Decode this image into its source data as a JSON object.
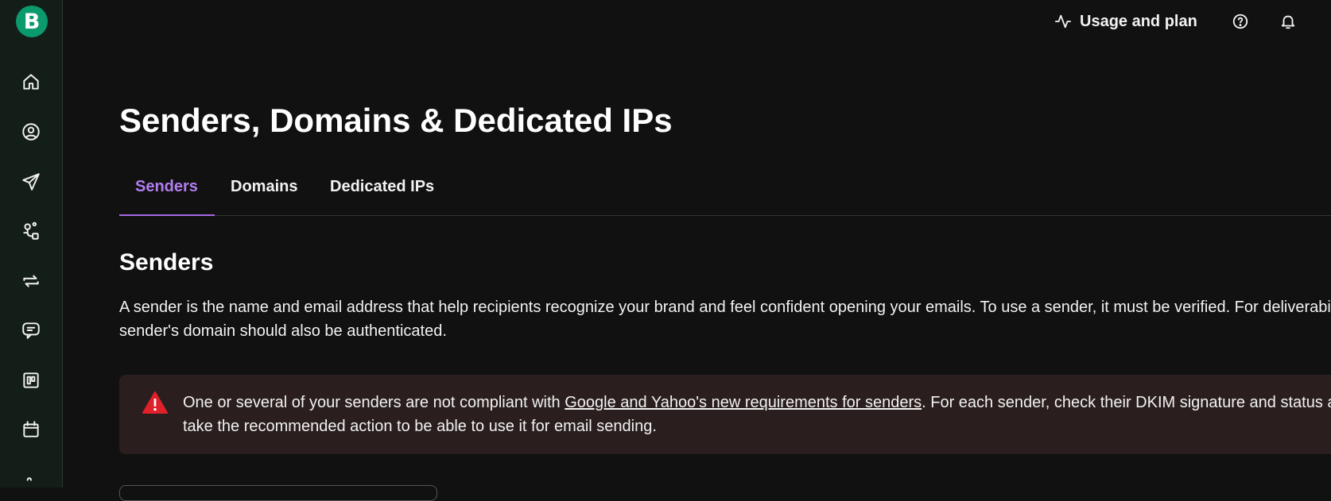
{
  "sidebar": {
    "logo_letter": "B",
    "items": [
      {
        "icon": "home-icon"
      },
      {
        "icon": "contacts-icon"
      },
      {
        "icon": "campaigns-icon"
      },
      {
        "icon": "automations-icon"
      },
      {
        "icon": "transactional-icon"
      },
      {
        "icon": "conversations-icon"
      },
      {
        "icon": "deals-icon"
      },
      {
        "icon": "meetings-icon"
      }
    ]
  },
  "topbar": {
    "usage_label": "Usage and plan",
    "help_icon": "help-icon",
    "notifications_icon": "bell-icon"
  },
  "page": {
    "title": "Senders, Domains & Dedicated IPs",
    "tabs": [
      {
        "label": "Senders",
        "active": true
      },
      {
        "label": "Domains",
        "active": false
      },
      {
        "label": "Dedicated IPs",
        "active": false
      }
    ]
  },
  "senders": {
    "heading": "Senders",
    "description": "A sender is the name and email address that help recipients recognize your brand and feel confident opening your emails. To use a sender, it must be verified. For deliverability, your sender's domain should also be authenticated.",
    "alert": {
      "text_before": "One or several of your senders are not compliant with ",
      "link_text": "Google and Yahoo's new requirements for senders",
      "text_after": ". For each sender, check their DKIM signature and status and take the recommended action to be able to use it for email sending."
    }
  },
  "colors": {
    "accent": "#b27ef0",
    "brand": "#0b996e",
    "alert_red": "#e0202a",
    "alert_bg": "#2a1f1e"
  }
}
